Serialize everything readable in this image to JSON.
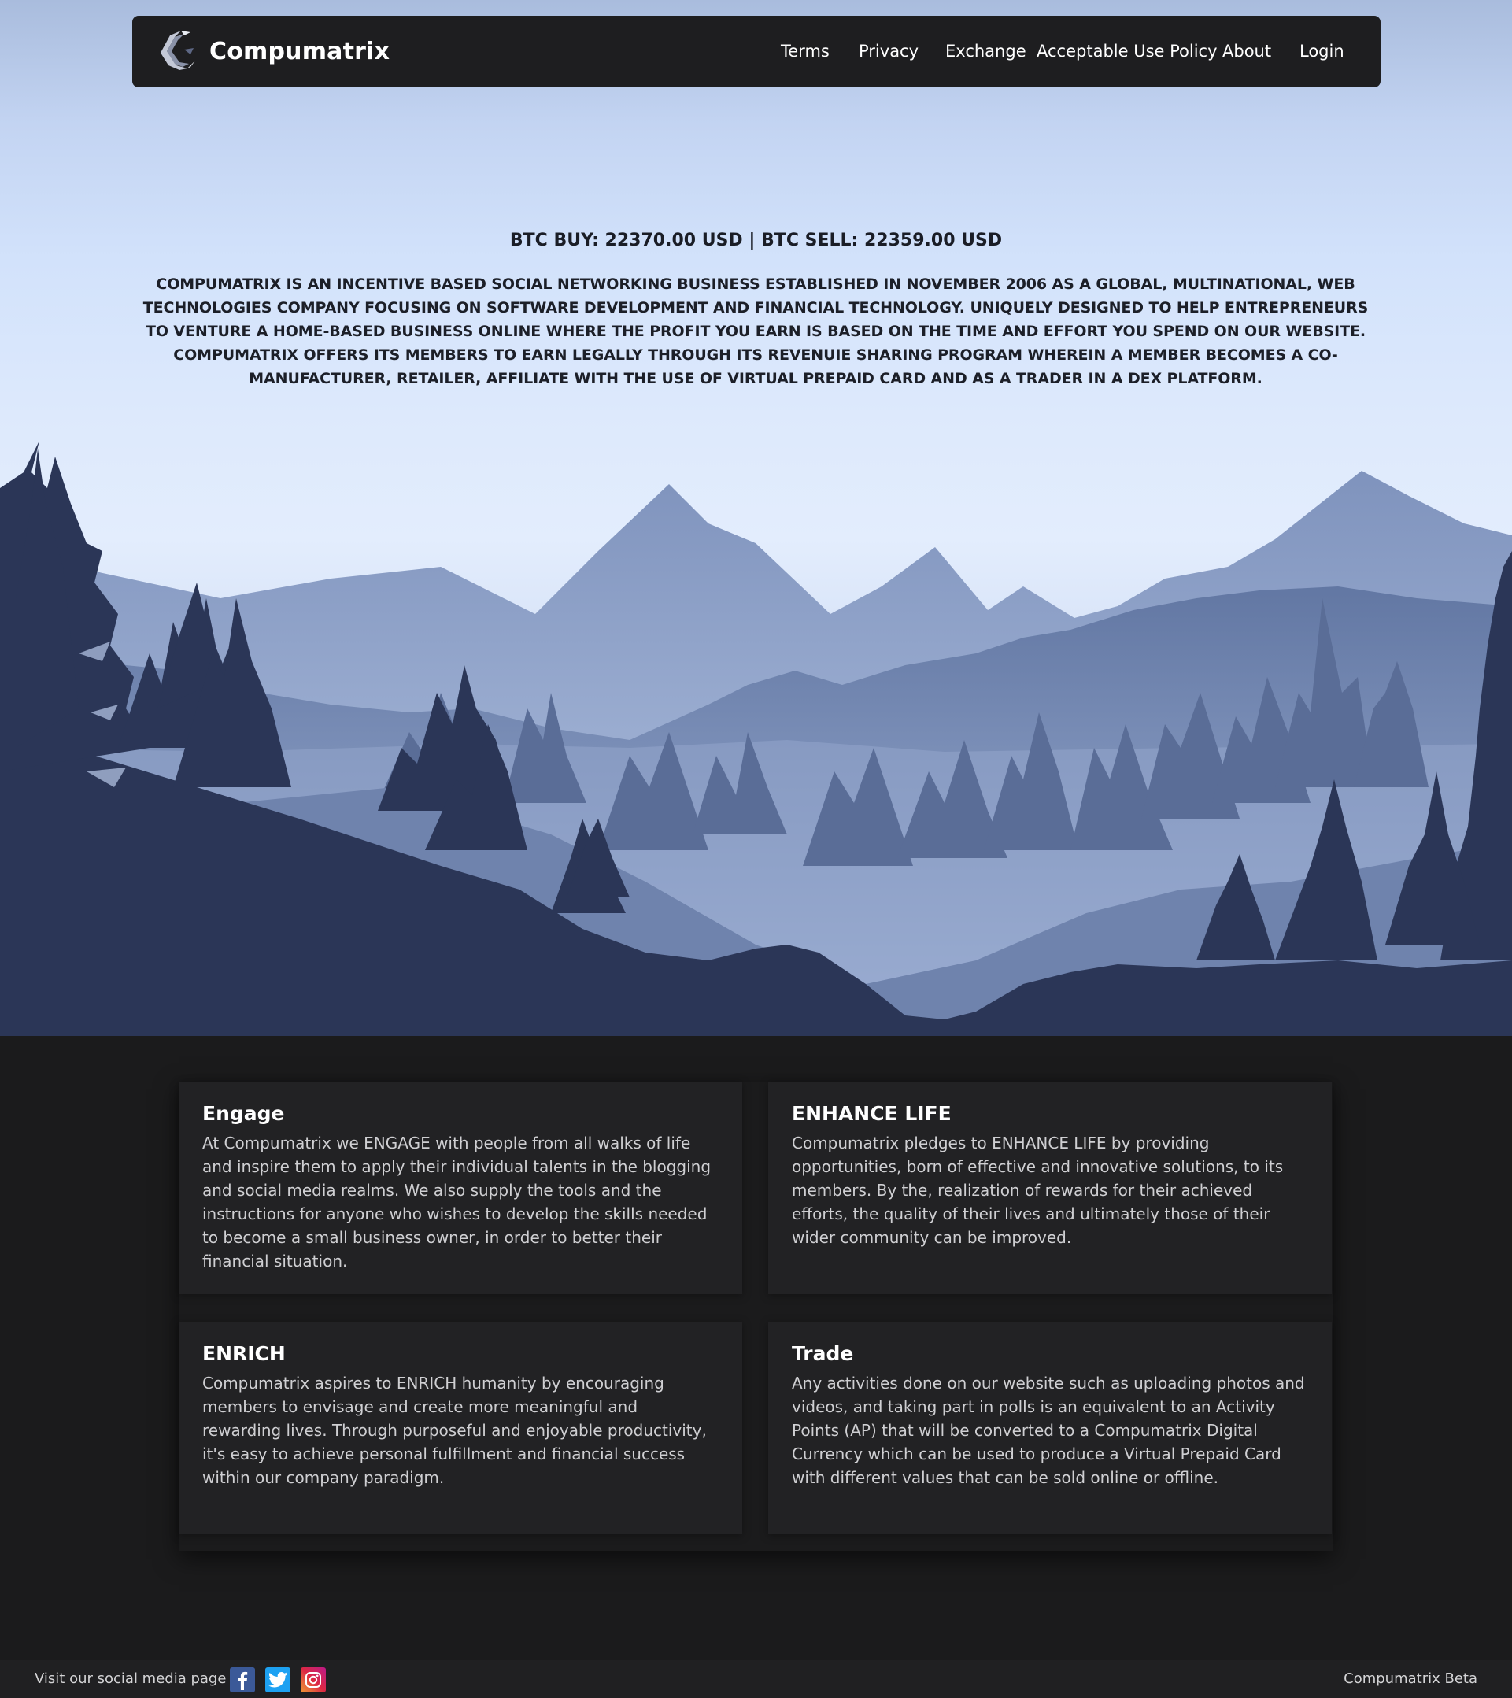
{
  "brand": {
    "name": "Compumatrix"
  },
  "nav": {
    "items": [
      {
        "label": "Terms"
      },
      {
        "label": "Privacy"
      },
      {
        "label": "Exchange"
      },
      {
        "label": "Acceptable Use Policy"
      },
      {
        "label": "About"
      },
      {
        "label": "Login"
      }
    ]
  },
  "hero": {
    "ticker": "BTC BUY: 22370.00 USD | BTC SELL: 22359.00 USD",
    "intro": "COMPUMATRIX IS AN INCENTIVE BASED SOCIAL NETWORKING BUSINESS ESTABLISHED IN NOVEMBER 2006 AS A GLOBAL, MULTINATIONAL, WEB TECHNOLOGIES COMPANY FOCUSING ON SOFTWARE DEVELOPMENT AND FINANCIAL TECHNOLOGY. UNIQUELY DESIGNED TO HELP ENTREPRENEURS TO VENTURE A HOME-BASED BUSINESS ONLINE WHERE THE PROFIT YOU EARN IS BASED ON THE TIME AND EFFORT YOU SPEND ON OUR WEBSITE. COMPUMATRIX OFFERS ITS MEMBERS TO EARN LEGALLY THROUGH ITS REVENUIE SHARING PROGRAM WHEREIN A MEMBER BECOMES A CO-MANUFACTURER, RETAILER, AFFILIATE WITH THE USE OF VIRTUAL PREPAID CARD AND AS A TRADER IN A DEX PLATFORM."
  },
  "cards": [
    {
      "title": "Engage",
      "body": "At Compumatrix we ENGAGE with people from all walks of life and inspire them to apply their individual talents in the blogging and social media realms. We also supply the tools and the instructions for anyone who wishes to develop the skills needed to become a small business owner, in order to better their financial situation."
    },
    {
      "title": "ENHANCE LIFE",
      "body": "Compumatrix pledges to ENHANCE LIFE by providing opportunities, born of effective and innovative solutions, to its members. By the, realization of rewards for their achieved efforts, the quality of their lives and ultimately those of their wider community can be improved."
    },
    {
      "title": "ENRICH",
      "body": "Compumatrix aspires to ENRICH humanity by encouraging members to envisage and create more meaningful and rewarding lives. Through purposeful and enjoyable productivity, it's easy to achieve personal fulfillment and financial success within our company paradigm."
    },
    {
      "title": "Trade",
      "body": "Any activities done on our website such as uploading photos and videos, and taking part in polls is an equivalent to an Activity Points (AP) that will be converted to a Compumatrix Digital Currency which can be used to produce a Virtual Prepaid Card with different values that can be sold online or offline."
    }
  ],
  "footer": {
    "social_label": "Visit our social media page",
    "social": [
      {
        "icon": "facebook-icon",
        "color": "#3b5998"
      },
      {
        "icon": "twitter-icon",
        "color": "#1da1f2"
      },
      {
        "icon": "instagram-icon",
        "color": "#d6249f"
      }
    ],
    "right_text": "Compumatrix Beta"
  },
  "colors": {
    "navbar": "#1e1e20",
    "page_background": "#1b1b1c",
    "card_background": "#222224",
    "forest_dark": "#2b3657"
  }
}
